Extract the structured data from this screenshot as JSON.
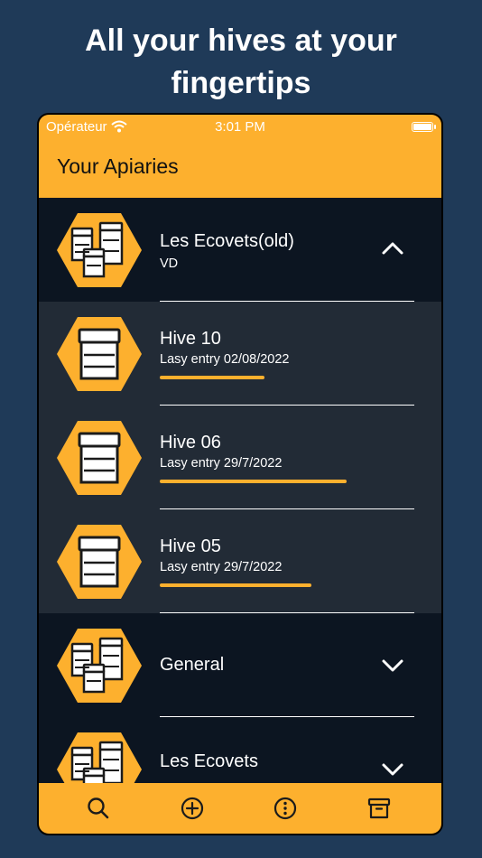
{
  "headline": {
    "line1": "All your hives at your",
    "line2": "fingertips"
  },
  "status_bar": {
    "carrier": "Opérateur",
    "time": "3:01 PM"
  },
  "nav": {
    "title": "Your Apiaries"
  },
  "colors": {
    "accent": "#fdb02e",
    "background": "#1f3a58",
    "list_dark": "#0c1521",
    "hive_row": "#222b36"
  },
  "apiaries": [
    {
      "name": "Les Ecovets(old)",
      "subtitle": "VD",
      "expanded": true,
      "chevron": "chevron-up-icon",
      "hives": [
        {
          "name": "Hive 10",
          "entry": "Lasy entry 02/08/2022",
          "progress": 0.41
        },
        {
          "name": "Hive 06",
          "entry": "Lasy entry 29/7/2022",
          "progress": 0.73
        },
        {
          "name": "Hive 05",
          "entry": "Lasy entry 29/7/2022",
          "progress": 0.59
        }
      ]
    },
    {
      "name": "General",
      "expanded": false,
      "chevron": "chevron-down-icon"
    },
    {
      "name": "Les Ecovets",
      "expanded": false,
      "chevron": "chevron-down-icon"
    }
  ],
  "tabbar": {
    "icons": [
      "search-icon",
      "add-circle-icon",
      "more-circle-icon",
      "archive-icon"
    ]
  }
}
